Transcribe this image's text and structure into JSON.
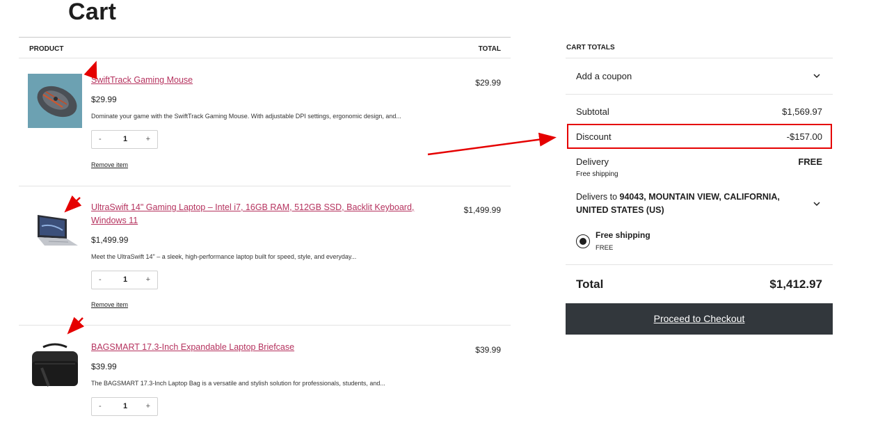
{
  "page": {
    "title": "Cart"
  },
  "table": {
    "product_header": "PRODUCT",
    "total_header": "TOTAL"
  },
  "items": [
    {
      "name": "SwiftTrack Gaming Mouse",
      "price": "$29.99",
      "description": "Dominate your game with the SwiftTrack Gaming Mouse. With adjustable DPI settings, ergonomic design, and...",
      "quantity": "1",
      "remove_label": "Remove item",
      "line_total": "$29.99",
      "image": "gaming-mouse"
    },
    {
      "name": "UltraSwift 14\" Gaming Laptop – Intel i7, 16GB RAM, 512GB SSD, Backlit Keyboard, Windows 11",
      "price": "$1,499.99",
      "description": "Meet the UltraSwift 14\" – a sleek, high-performance laptop built for speed, style, and everyday...",
      "quantity": "1",
      "remove_label": "Remove item",
      "line_total": "$1,499.99",
      "image": "laptop"
    },
    {
      "name": "BAGSMART 17.3-Inch Expandable Laptop Briefcase",
      "price": "$39.99",
      "description": "The BAGSMART 17.3-Inch Laptop Bag is a versatile and stylish solution for professionals, students, and...",
      "quantity": "1",
      "line_total": "$39.99",
      "image": "briefcase"
    }
  ],
  "qty_controls": {
    "minus": "-",
    "plus": "+"
  },
  "totals": {
    "heading": "CART TOTALS",
    "coupon_label": "Add a coupon",
    "subtotal_label": "Subtotal",
    "subtotal_value": "$1,569.97",
    "discount_label": "Discount",
    "discount_value": "-$157.00",
    "delivery_label": "Delivery",
    "delivery_value": "FREE",
    "delivery_note": "Free shipping",
    "delivers_to_prefix": "Delivers to ",
    "delivers_to_address": "94043, MOUNTAIN VIEW, CALIFORNIA, UNITED STATES (US)",
    "shipping_option_name": "Free shipping",
    "shipping_option_price": "FREE",
    "total_label": "Total",
    "total_value": "$1,412.97",
    "checkout_label": "Proceed to Checkout"
  },
  "colors": {
    "link": "#b5325e",
    "button_bg": "#32373c",
    "annotation": "#e50000"
  }
}
